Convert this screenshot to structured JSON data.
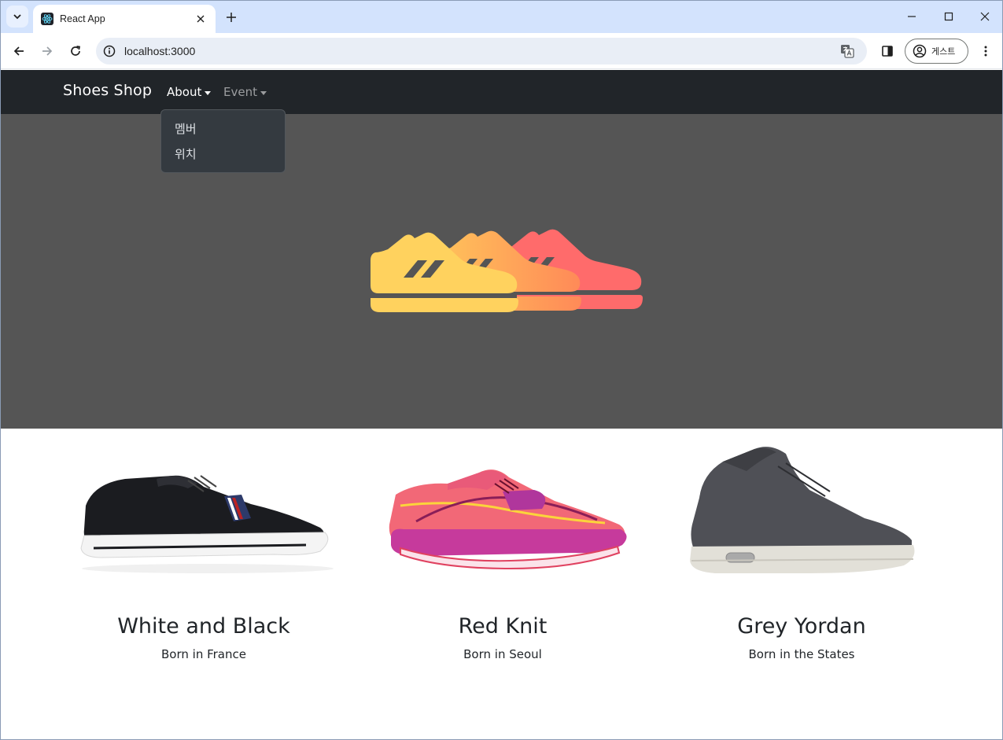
{
  "browser": {
    "tab_title": "React App",
    "url": "localhost:3000",
    "profile_label": "게스트"
  },
  "navbar": {
    "brand": "Shoes Shop",
    "links": [
      {
        "label": "About",
        "active": true
      },
      {
        "label": "Event",
        "active": false
      }
    ],
    "dropdown_items": [
      "멤버",
      "위치"
    ]
  },
  "colors": {
    "navbar_bg": "#212529",
    "hero_bg": "#555555",
    "logo_yellow": "#ffd25e",
    "logo_orange": "#ff9f50",
    "logo_red": "#ff6b6b",
    "tab_strip": "#d3e3fd"
  },
  "products": [
    {
      "title": "White and Black",
      "subtitle": "Born in France",
      "icon": "black-sneaker-image"
    },
    {
      "title": "Red Knit",
      "subtitle": "Born in Seoul",
      "icon": "pink-running-shoe-image"
    },
    {
      "title": "Grey Yordan",
      "subtitle": "Born in the States",
      "icon": "grey-high-top-image"
    }
  ]
}
